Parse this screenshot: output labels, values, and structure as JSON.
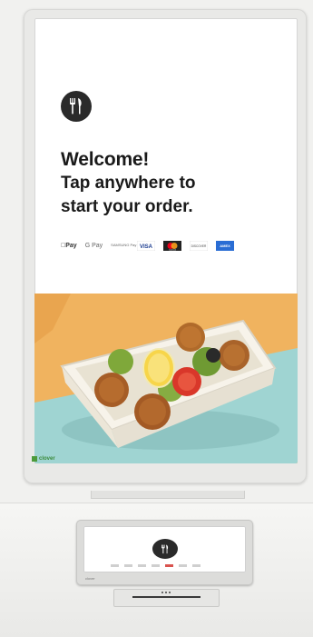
{
  "welcome": {
    "title": "Welcome!",
    "line1": "Tap anywhere to",
    "line2": "start your order."
  },
  "payments": {
    "apple_pay": "Pay",
    "google_pay": "G Pay",
    "samsung_pay": "SAMSUNG Pay",
    "visa": "VISA",
    "mastercard": "mastercard",
    "discover": "DISCOVER",
    "amex": "AMEX"
  },
  "brand": {
    "screen_logo": "clover",
    "device_label": "clover"
  },
  "icons": {
    "restaurant": "fork-knife-icon"
  },
  "colors": {
    "screen_bg": "#ffffff",
    "photo_orange": "#f0b35f",
    "photo_teal": "#9fd4d2",
    "text_dark": "#1a1a1a",
    "clover_green": "#4c9a3b"
  }
}
